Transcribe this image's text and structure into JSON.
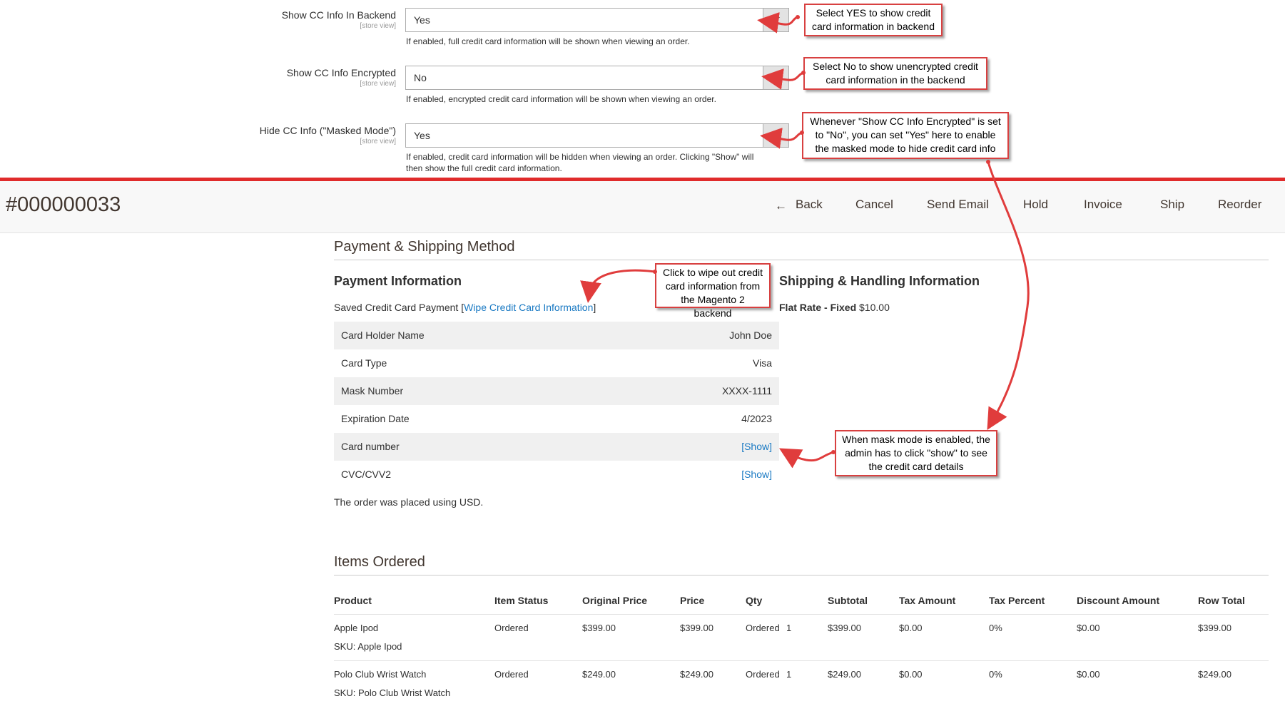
{
  "config": {
    "rows": [
      {
        "label": "Show CC Info In Backend",
        "scope": "[store view]",
        "value": "Yes",
        "note": "If enabled, full credit card information will be shown when viewing an order."
      },
      {
        "label": "Show CC Info Encrypted",
        "scope": "[store view]",
        "value": "No",
        "note": "If enabled, encrypted credit card information will be shown when viewing an order."
      },
      {
        "label": "Hide CC Info (\"Masked Mode\")",
        "scope": "[store view]",
        "value": "Yes",
        "note_line1": "If enabled, credit card information will be hidden when viewing an order. Clicking \"Show\" will",
        "note_line2": "then show the full credit card information."
      }
    ]
  },
  "callouts": {
    "c1_line1": "Select YES to show credit",
    "c1_line2": "card information in backend",
    "c2_line1": "Select No to show unencrypted credit",
    "c2_line2": "card information in the backend",
    "c3_line1": "Whenever \"Show CC Info Encrypted\" is set",
    "c3_line2": "to \"No\", you can set \"Yes\" here to enable",
    "c3_line3": "the masked mode to hide credit card info",
    "c4_line1": "Click to wipe out credit",
    "c4_line2": "card information from",
    "c4_line3": "the Magento 2 backend",
    "c5_line1": "When mask mode is enabled, the",
    "c5_line2": "admin has to click \"show\" to see",
    "c5_line3": "the credit card details"
  },
  "order": {
    "title": "#000000033",
    "actions": {
      "back": "Back",
      "cancel": "Cancel",
      "send_email": "Send Email",
      "hold": "Hold",
      "invoice": "Invoice",
      "ship": "Ship",
      "reorder": "Reorder"
    }
  },
  "payment_shipping": {
    "section_title": "Payment & Shipping Method",
    "payment_title": "Payment Information",
    "saved_prefix": "Saved Credit Card Payment [",
    "wipe_link": "Wipe Credit Card Information",
    "saved_suffix": "]",
    "cc_rows": [
      {
        "key": "Card Holder Name",
        "value": "John Doe"
      },
      {
        "key": "Card Type",
        "value": "Visa"
      },
      {
        "key": "Mask Number",
        "value": "XXXX-1111"
      },
      {
        "key": "Expiration Date",
        "value": "4/2023"
      },
      {
        "key": "Card number",
        "value": "[Show]"
      },
      {
        "key": "CVC/CVV2",
        "value": "[Show]"
      }
    ],
    "currency_note": "The order was placed using USD.",
    "shipping_title": "Shipping & Handling Information",
    "shipping_method": "Flat Rate - Fixed",
    "shipping_price": "$10.00"
  },
  "items": {
    "section_title": "Items Ordered",
    "headers": [
      "Product",
      "Item Status",
      "Original Price",
      "Price",
      "Qty",
      "Subtotal",
      "Tax Amount",
      "Tax Percent",
      "Discount Amount",
      "Row Total"
    ],
    "rows": [
      {
        "product": "Apple Ipod",
        "sku": "SKU: Apple Ipod",
        "status": "Ordered",
        "original_price": "$399.00",
        "price": "$399.00",
        "qty_label": "Ordered",
        "qty": "1",
        "subtotal": "$399.00",
        "tax_amount": "$0.00",
        "tax_percent": "0%",
        "discount": "$0.00",
        "row_total": "$399.00"
      },
      {
        "product": "Polo Club Wrist Watch",
        "sku": "SKU: Polo Club Wrist Watch",
        "status": "Ordered",
        "original_price": "$249.00",
        "price": "$249.00",
        "qty_label": "Ordered",
        "qty": "1",
        "subtotal": "$249.00",
        "tax_amount": "$0.00",
        "tax_percent": "0%",
        "discount": "$0.00",
        "row_total": "$249.00"
      }
    ]
  },
  "colors": {
    "accent_red": "#e02b2b",
    "link_blue": "#1979c3",
    "header_bg": "#f8f8f8"
  }
}
